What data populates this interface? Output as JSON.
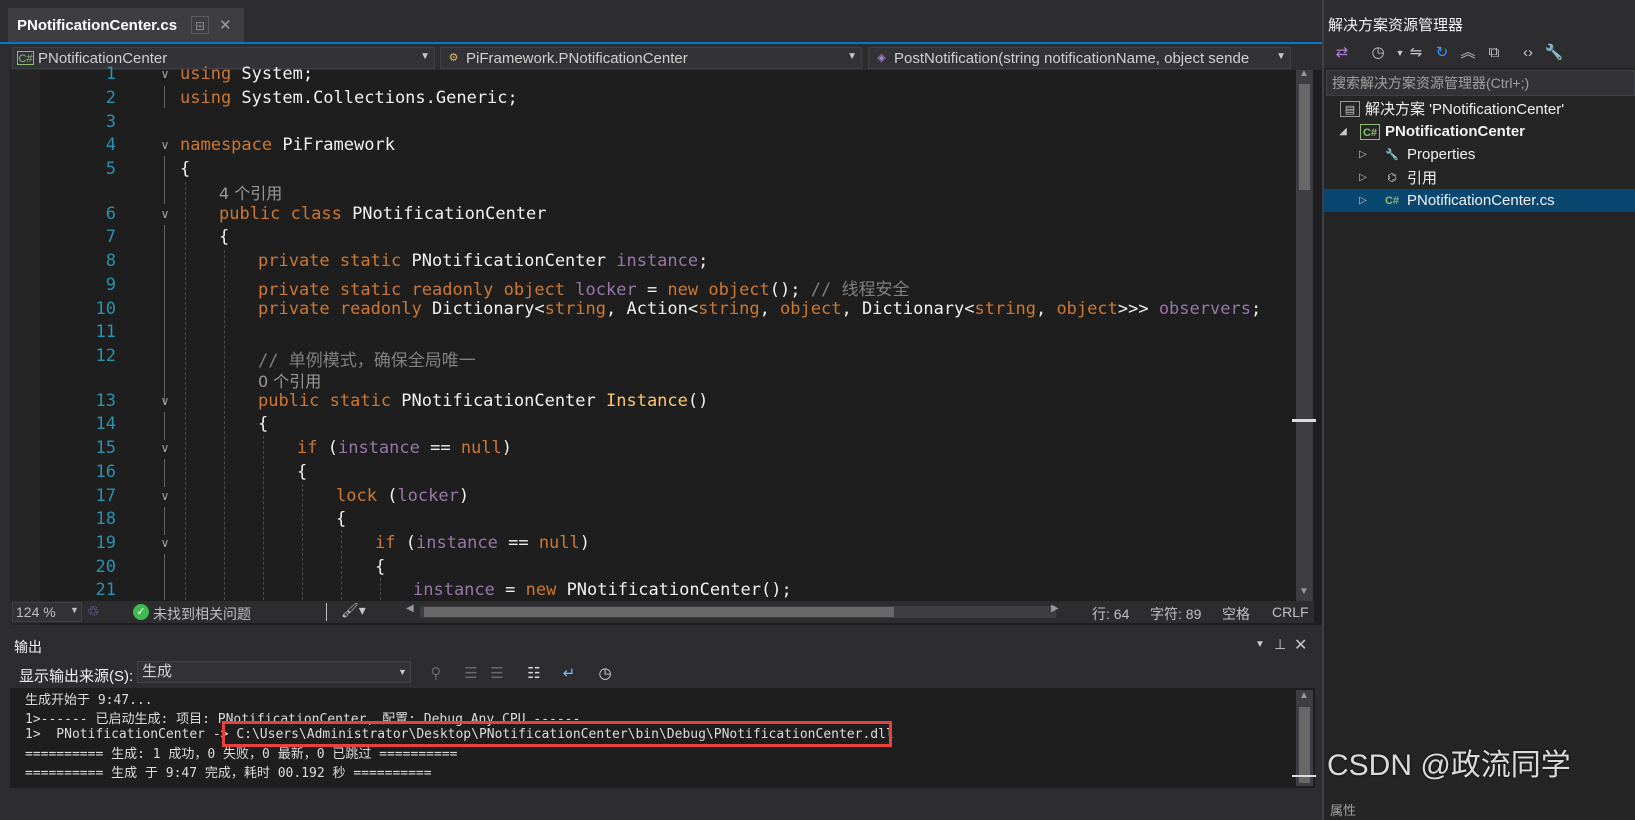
{
  "editor_tab": {
    "filename": "PNotificationCenter.cs",
    "pin_glyph": "⊟",
    "close_glyph": "✕"
  },
  "navbar": {
    "project": "PNotificationCenter",
    "type": "PiFramework.PNotificationCenter",
    "member": "PostNotification(string notificationName, object sende"
  },
  "code": {
    "line_numbers": [
      "1",
      "2",
      "3",
      "4",
      "5",
      "6",
      "7",
      "8",
      "9",
      "10",
      "11",
      "12",
      "13",
      "14",
      "15",
      "16",
      "17",
      "18",
      "19",
      "20",
      "21"
    ],
    "using1_kw": "using",
    "using1_ns": " System;",
    "using2_kw": "using",
    "using2_ns": " System.Collections.Generic;",
    "ns_kw": "namespace",
    "ns_name": " PiFramework",
    "brace_open": "{",
    "refs_4": "4 个引用",
    "class_kw": "public class",
    "class_name": " PNotificationCenter",
    "l8_kw": "private static",
    "l8_type": " PNotificationCenter ",
    "l8_field": "instance",
    "l8_end": ";",
    "l9_kw": "private static readonly object",
    "l9_field": " locker",
    "l9_eq": " = ",
    "l9_new": "new object",
    "l9_par": "(); ",
    "l9_cmt": "// 线程安全",
    "l10_kw": "private readonly",
    "l10_a": " Dictionary<",
    "l10_s1": "string",
    "l10_b": ", Action<",
    "l10_s2": "string",
    "l10_c": ", ",
    "l10_o1": "object",
    "l10_d": ", Dictionary<",
    "l10_s3": "string",
    "l10_e": ", ",
    "l10_o2": "object",
    "l10_f": ">>> ",
    "l10_field": "observers",
    "l10_end": ";",
    "l12_cmt": "// 单例模式，确保全局唯一",
    "refs_0": "0 个引用",
    "l13_kw": "public static",
    "l13_type": " PNotificationCenter ",
    "l13_method": "Instance",
    "l13_par": "()",
    "if_kw": "if",
    "if_open": " (",
    "if_field": "instance",
    "if_op": " == ",
    "if_null": "null",
    "if_close": ")",
    "lock_kw": "lock",
    "lock_open": " (",
    "lock_field": "locker",
    "lock_close": ")",
    "l21_field": "instance",
    "l21_eq": " = ",
    "l21_new": "new",
    "l21_rest": " PNotificationCenter();"
  },
  "editor_status": {
    "zoom": "124 %",
    "health": "未找到相关问题",
    "line": "行: 64",
    "col": "字符: 89",
    "spacing": "空格",
    "eol": "CRLF"
  },
  "output": {
    "title": "输出",
    "source_label": "显示输出来源(S):",
    "source_value": "生成",
    "lines": [
      "生成开始于 9:47...",
      "1>------ 已启动生成: 项目: PNotificationCenter, 配置: Debug Any CPU ------",
      "1>  PNotificationCenter -> C:\\Users\\Administrator\\Desktop\\PNotificationCenter\\bin\\Debug\\PNotificationCenter.dll",
      "========== 生成: 1 成功，0 失败，0 最新，0 已跳过 ==========",
      "========== 生成 于 9:47 完成，耗时 00.192 秒 =========="
    ]
  },
  "solution_explorer": {
    "title": "解决方案资源管理器",
    "search_placeholder": "搜索解决方案资源管理器(Ctrl+;)",
    "solution": "解决方案 'PNotificationCenter'",
    "project": "PNotificationCenter",
    "properties": "Properties",
    "references": "引用",
    "file": "PNotificationCenter.cs",
    "properties_panel": "属性"
  },
  "watermark": "CSDN @政流同学",
  "colors": {
    "accent": "#007acc",
    "keyword": "#cc7832",
    "field": "#9876aa",
    "method": "#ffc66d",
    "highlight_box": "#e8413d",
    "selection": "#094771"
  }
}
